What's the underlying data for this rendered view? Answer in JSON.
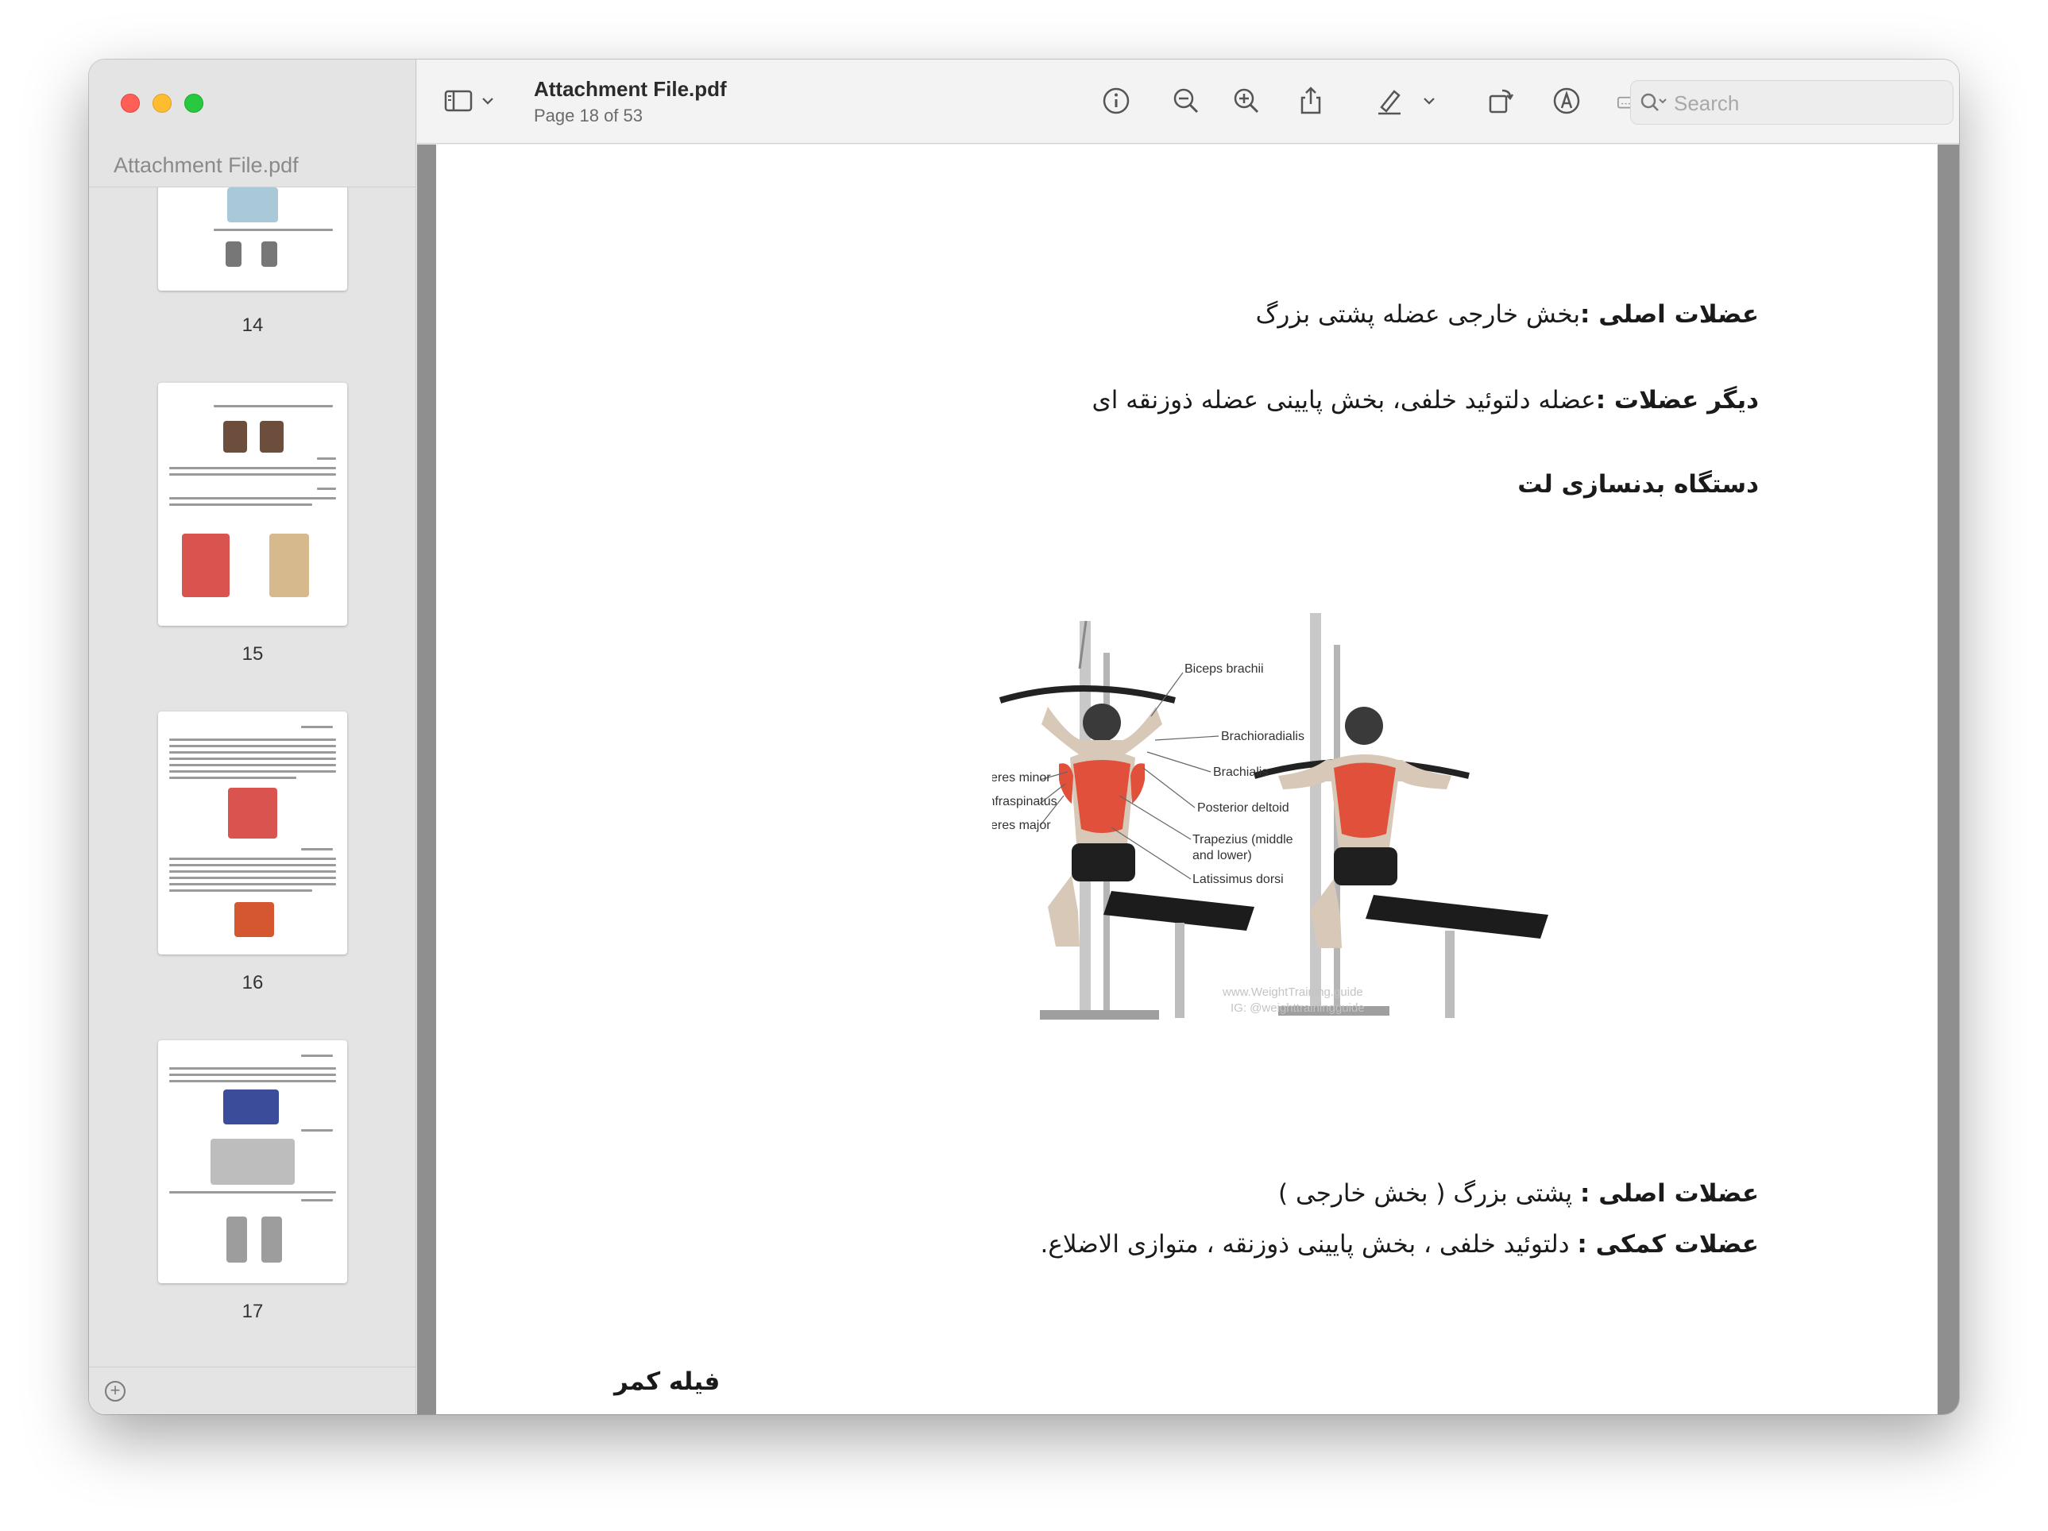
{
  "window": {
    "sidebar_title": "Attachment File.pdf",
    "doc_title": "Attachment File.pdf",
    "page_indicator": "Page 18 of 53"
  },
  "toolbar": {
    "search_placeholder": "Search",
    "icons": [
      "sidebar-toggle-icon",
      "chevron-down-icon",
      "info-icon",
      "zoom-out-icon",
      "zoom-in-icon",
      "share-icon",
      "highlight-pen-icon",
      "chevron-down-icon",
      "rotate-icon",
      "markup-icon",
      "signature-icon",
      "search-icon"
    ]
  },
  "thumbnails": [
    {
      "page": "14"
    },
    {
      "page": "15"
    },
    {
      "page": "16"
    },
    {
      "page": "17"
    }
  ],
  "document": {
    "line1_bold": "عضلات اصلی :",
    "line1_rest": "بخش خارجی عضله پشتی بزرگ",
    "line2_bold": "دیگر عضلات :",
    "line2_rest": "عضله دلتوئید خلفی، بخش پایینی عضله ذوزنقه ای",
    "heading1": "دستگاه بدنسازی لت",
    "line4_bold": "عضلات اصلی :",
    "line4_rest": " پشتی بزرگ ( بخش خارجی )",
    "line5_bold": "عضلات کمکی :",
    "line5_rest": " دلتوئید خلفی ، بخش پایینی ذوزنقه ، متوازی الاضلاع.",
    "heading2": "فیله کمر"
  },
  "figure": {
    "labels": {
      "biceps": "Biceps brachii",
      "brachioradialis": "Brachioradialis",
      "brachialis": "Brachialis",
      "post_deltoid": "Posterior deltoid",
      "trapezius_1": "Trapezius (middle",
      "trapezius_2": "and lower)",
      "latissimus": "Latissimus dorsi",
      "teres_minor": "Teres minor",
      "infraspinatus": "Infraspinatus",
      "teres_major": "Teres major",
      "watermark_1": "www.WeightTraining.guide",
      "watermark_2": "IG: @weighttrainingguide"
    },
    "colors": {
      "muscle": "#e0503a",
      "skin": "#d8c8b8",
      "bench": "#1c1c1c",
      "frame": "#bfbfbf"
    }
  },
  "colors": {
    "close": "#ff5f57",
    "minimize": "#febc2e",
    "maximize": "#28c840",
    "content_bg": "#8f8f8f"
  }
}
